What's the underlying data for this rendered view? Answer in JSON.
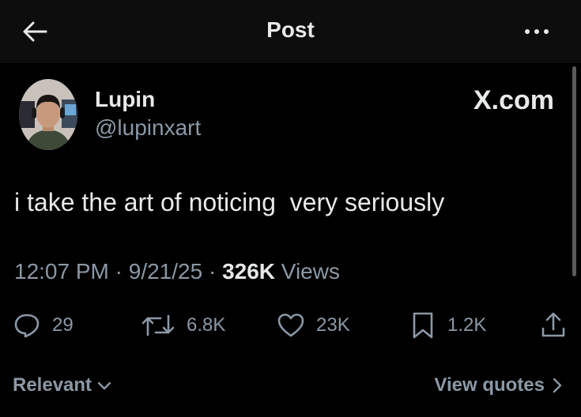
{
  "header": {
    "back_icon": "arrow-left-icon",
    "title": "Post",
    "more_icon": "more-horizontal-icon"
  },
  "author": {
    "name": "Lupin",
    "handle": "@lupinxart",
    "avatar_icon": "avatar-photo"
  },
  "source_logo": "X.com",
  "post": {
    "text": "i take the art of noticing  very seriously"
  },
  "meta": {
    "time": "12:07 PM",
    "sep1": " · ",
    "date": "9/21/25",
    "sep2": " · ",
    "views_count": "326K",
    "views_label": " Views"
  },
  "actions": {
    "replies": {
      "icon": "reply-icon",
      "count": "29"
    },
    "reposts": {
      "icon": "repost-icon",
      "count": "6.8K"
    },
    "likes": {
      "icon": "heart-icon",
      "count": "23K"
    },
    "bookmarks": {
      "icon": "bookmark-icon",
      "count": "1.2K"
    },
    "share": {
      "icon": "share-icon"
    }
  },
  "footer": {
    "sort_label": "Relevant",
    "view_quotes_label": "View quotes"
  },
  "colors": {
    "background": "#000000",
    "header_background": "#0d0d0d",
    "text_primary": "#e7e9ea",
    "text_secondary": "#8b98a5"
  }
}
